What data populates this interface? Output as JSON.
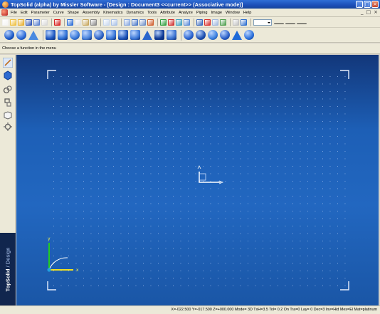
{
  "window": {
    "title": "TopSolid (alpha) by Missler Software - [Design : Document3  <<current>> (Associative mode)]",
    "buttons": [
      "minimize-icon",
      "maximize-icon",
      "close-icon"
    ]
  },
  "menu": {
    "items": [
      "File",
      "Edit",
      "Parameter",
      "Curve",
      "Shape",
      "Assembly",
      "Kinematics",
      "Dynamics",
      "Tools",
      "Attribute",
      "Analyze",
      "Piping",
      "Image",
      "Window",
      "Help"
    ],
    "mdi_buttons": [
      "_",
      "□",
      "×"
    ]
  },
  "toolbar": {
    "standard_icons": [
      {
        "name": "new-document-icon",
        "color": "#f3f3f3"
      },
      {
        "name": "open-icon",
        "color": "#f0c040"
      },
      {
        "name": "open-folder-icon",
        "color": "#e8b030"
      },
      {
        "name": "save-icon",
        "color": "#3558b8"
      },
      {
        "name": "save-as-icon",
        "color": "#5a80d0"
      },
      {
        "name": "print-icon",
        "color": "#d8d8d8"
      },
      {
        "name": "delete-icon",
        "color": "#d82020"
      },
      {
        "name": "undo-icon",
        "color": "#2a6cd8"
      },
      {
        "name": "copy-icon",
        "color": "#e0e0e0"
      },
      {
        "name": "paste-icon",
        "color": "#c8a860"
      },
      {
        "name": "cut-icon",
        "color": "#8a8a8a"
      },
      {
        "name": "zoom-window-icon",
        "color": "#c8d8f0"
      },
      {
        "name": "zoom-all-icon",
        "color": "#a8c0e8"
      },
      {
        "name": "view-icon",
        "color": "#88a8e0"
      },
      {
        "name": "shade-icon",
        "color": "#4a78c8"
      },
      {
        "name": "wireframe-icon",
        "color": "#7090c8"
      },
      {
        "name": "hide-icon",
        "color": "#d06030"
      },
      {
        "name": "layer-icon",
        "color": "#30a040"
      },
      {
        "name": "color-icon",
        "color": "#d03030"
      },
      {
        "name": "ruler-icon",
        "color": "#40a0c0"
      },
      {
        "name": "snap-icon",
        "color": "#5a8ad8"
      },
      {
        "name": "measure-icon",
        "color": "#3a6ac0"
      },
      {
        "name": "point-icon",
        "color": "#d83030"
      },
      {
        "name": "frame-icon",
        "color": "#a0b8e0"
      },
      {
        "name": "grid-icon",
        "color": "#50a050"
      },
      {
        "name": "properties-icon",
        "color": "#c0c0c0"
      },
      {
        "name": "render-icon",
        "color": "#3070d0"
      }
    ],
    "line_icons": [
      "point-style-icon",
      "line-style-icon",
      "line-width-icon"
    ]
  },
  "toolbar2": {
    "icons": [
      {
        "name": "sphere-icon",
        "color": "#1e5cc8",
        "shape": "round"
      },
      {
        "name": "cylinder-icon",
        "color": "#2a6ad8",
        "shape": "round"
      },
      {
        "name": "cone-icon",
        "color": "#4a8ae0",
        "shape": "tri"
      },
      {
        "name": "box-icon",
        "color": "#1d57c0",
        "shape": "box"
      },
      {
        "name": "extrude-icon",
        "color": "#2d6fd4",
        "shape": "box"
      },
      {
        "name": "revolve-icon",
        "color": "#3777d8",
        "shape": "round"
      },
      {
        "name": "sweep-icon",
        "color": "#4a84dc",
        "shape": "box"
      },
      {
        "name": "loft-icon",
        "color": "#2c62c4",
        "shape": "round"
      },
      {
        "name": "shell-icon",
        "color": "#3a76d8",
        "shape": "box"
      },
      {
        "name": "fillet-icon",
        "color": "#1e54b8",
        "shape": "box"
      },
      {
        "name": "chamfer-icon",
        "color": "#3c78d8",
        "shape": "box"
      },
      {
        "name": "draft-icon",
        "color": "#2a66cc",
        "shape": "tri"
      },
      {
        "name": "hole-icon",
        "color": "#0e3a96",
        "shape": "box"
      },
      {
        "name": "rib-icon",
        "color": "#3a72d0",
        "shape": "box"
      },
      {
        "name": "boolean-union-icon",
        "color": "#2a64d0",
        "shape": "round"
      },
      {
        "name": "boolean-cut-icon",
        "color": "#1c4fb0",
        "shape": "round"
      },
      {
        "name": "boolean-intersect-icon",
        "color": "#3a80e0",
        "shape": "round"
      },
      {
        "name": "pattern-icon",
        "color": "#2a5fc8",
        "shape": "round"
      },
      {
        "name": "mirror-icon",
        "color": "#1e6ad8",
        "shape": "tri"
      },
      {
        "name": "split-icon",
        "color": "#2a70dc",
        "shape": "round"
      }
    ]
  },
  "status": {
    "prompt": "Choose a function in the menu"
  },
  "sidebar": {
    "icons": [
      "sketch-icon",
      "part-icon",
      "assembly-icon",
      "kinematics-icon",
      "drawing-icon",
      "settings-icon"
    ],
    "brand_name": "TopSolid",
    "brand_module": "Design"
  },
  "canvas": {
    "axis_x": "x",
    "axis_y": "y"
  },
  "statusbar": {
    "coordinates": "X=-022.500   Y=-017.500   Z=+000.000  Mode=  3D  TxH=3.5     Tol=  0.2    On  Tra=0    Lay=  0    Dec=3    Inv=Hid  Mes=El  Mat=platinum"
  }
}
